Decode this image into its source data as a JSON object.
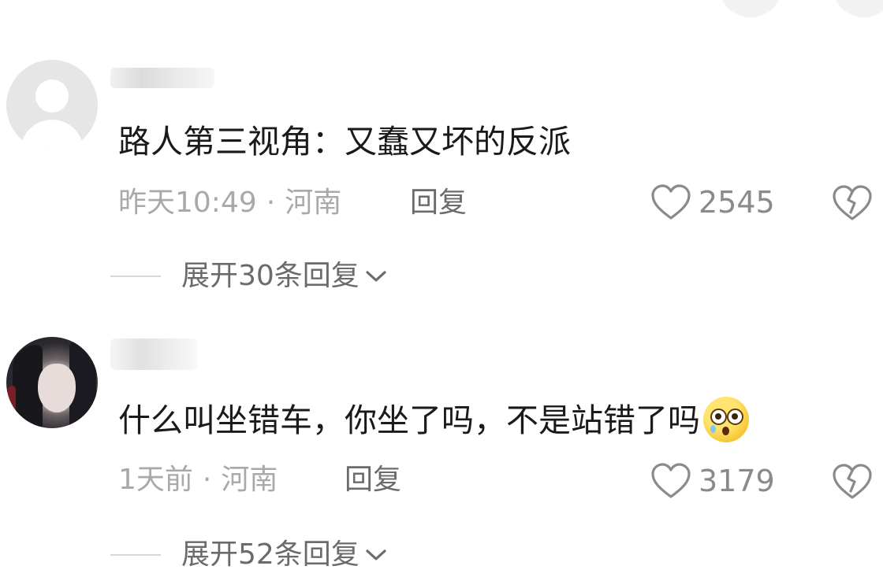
{
  "comments": [
    {
      "text": "路人第三视角：又蠢又坏的反派",
      "time": "昨天10:49",
      "location": "河南",
      "reply_label": "回复",
      "likes": "2545",
      "expand_label": "展开30条回复"
    },
    {
      "text": "什么叫坐错车，你坐了吗，不是站错了吗",
      "emoji": "scared-emoji",
      "time": "1天前",
      "location": "河南",
      "reply_label": "回复",
      "likes": "3179",
      "expand_label": "展开52条回复"
    }
  ],
  "separator": "·",
  "colors": {
    "text_primary": "#1a1a1a",
    "text_meta": "#a9a9a9",
    "text_secondary": "#6b6b6b",
    "icon": "#8a8a8a"
  },
  "icons": {
    "like": "heart-outline-icon",
    "dislike": "broken-heart-icon",
    "expand": "chevron-down-icon"
  }
}
